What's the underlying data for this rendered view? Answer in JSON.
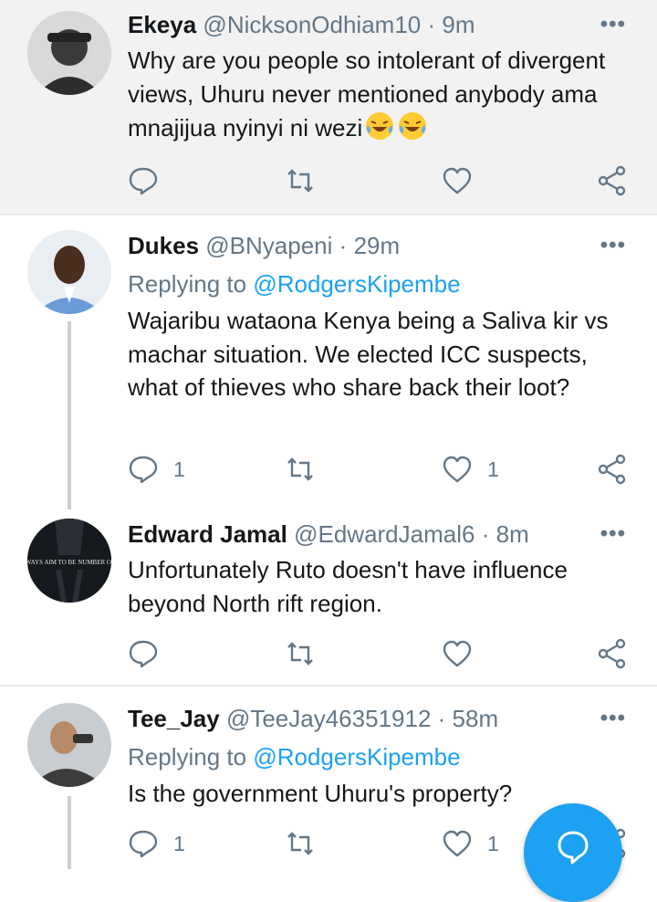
{
  "colors": {
    "accent": "#1da1f2",
    "muted": "#657786",
    "highlight_bg": "#f2f2f2"
  },
  "tweets": [
    {
      "name": "Ekeya",
      "handle": "@NicksonOdhiam10",
      "sep": "·",
      "time": "9m",
      "body": "Why are you people so intolerant of divergent views, Uhuru never mentioned anybody ama mnajijua nyinyi ni wezi",
      "emoji": [
        "face-with-tears-of-joy",
        "face-with-tears-of-joy"
      ],
      "reply_count": "",
      "like_count": ""
    },
    {
      "name": "Dukes",
      "handle": "@BNyapeni",
      "sep": "·",
      "time": "29m",
      "replying_label": "Replying to ",
      "replying_to": "@RodgersKipembe",
      "body": "Wajaribu wataona Kenya being a Saliva kir vs machar situation. We elected ICC suspects, what of thieves who share back their loot?",
      "reply_count": "1",
      "like_count": "1"
    },
    {
      "name": "Edward Jamal",
      "handle": "@EdwardJamal6",
      "sep": "·",
      "time": "8m",
      "avatar_text": "ALWAYS AIM TO BE NUMBER ONE.",
      "body": "Unfortunately Ruto doesn't have influence beyond North rift region.",
      "reply_count": "",
      "like_count": ""
    },
    {
      "name": "Tee_Jay",
      "handle": "@TeeJay46351912",
      "sep": "·",
      "time": "58m",
      "replying_label": "Replying to ",
      "replying_to": "@RodgersKipembe",
      "body": "Is the government Uhuru's property?",
      "reply_count": "1",
      "like_count": "1"
    }
  ],
  "more_icon": "•••",
  "icons": [
    "reply-icon",
    "retweet-icon",
    "like-icon",
    "share-icon",
    "more-icon",
    "compose-icon"
  ]
}
